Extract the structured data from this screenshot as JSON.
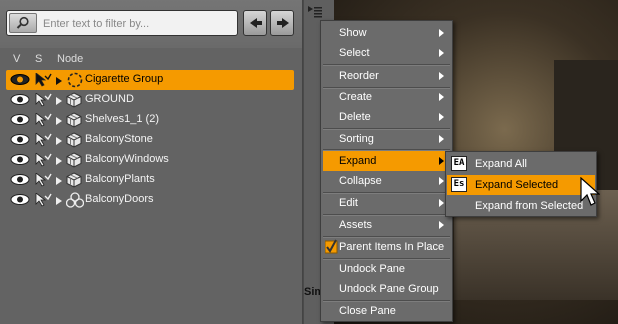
{
  "search": {
    "placeholder": "Enter text to filter by...",
    "icon": "search-icon",
    "back_icon": "arrow-left-icon",
    "forward_icon": "arrow-right-icon"
  },
  "columns": {
    "visible": "V",
    "selectable": "S",
    "node": "Node"
  },
  "nodes": [
    {
      "label": "Cigarette  Group",
      "type": "group",
      "selected": true
    },
    {
      "label": "GROUND",
      "type": "figure",
      "selected": false
    },
    {
      "label": "Shelves1_1 (2)",
      "type": "figure",
      "selected": false
    },
    {
      "label": "BalconyStone",
      "type": "figure",
      "selected": false
    },
    {
      "label": "BalconyWindows",
      "type": "figure",
      "selected": false
    },
    {
      "label": "BalconyPlants",
      "type": "figure",
      "selected": false
    },
    {
      "label": "BalconyDoors",
      "type": "group-node",
      "selected": false
    }
  ],
  "side_strip": {
    "label": "Simula"
  },
  "context_menu": {
    "show": "Show",
    "select": "Select",
    "reorder": "Reorder",
    "create": "Create",
    "delete": "Delete",
    "sorting": "Sorting",
    "expand": "Expand",
    "collapse": "Collapse",
    "edit": "Edit",
    "assets": "Assets",
    "parent_items_in_place": "Parent Items In Place",
    "undock_pane": "Undock Pane",
    "undock_pane_group": "Undock Pane Group",
    "close_pane": "Close Pane"
  },
  "expand_submenu": {
    "expand_all": "Expand All",
    "expand_all_icon_text": "EA",
    "expand_selected": "Expand Selected",
    "expand_selected_icon_text": "Es",
    "expand_from_selected": "Expand from Selected"
  },
  "colors": {
    "accent": "#f59a00",
    "menu_bg": "#6b6b6b",
    "pane_bg": "#636363"
  }
}
